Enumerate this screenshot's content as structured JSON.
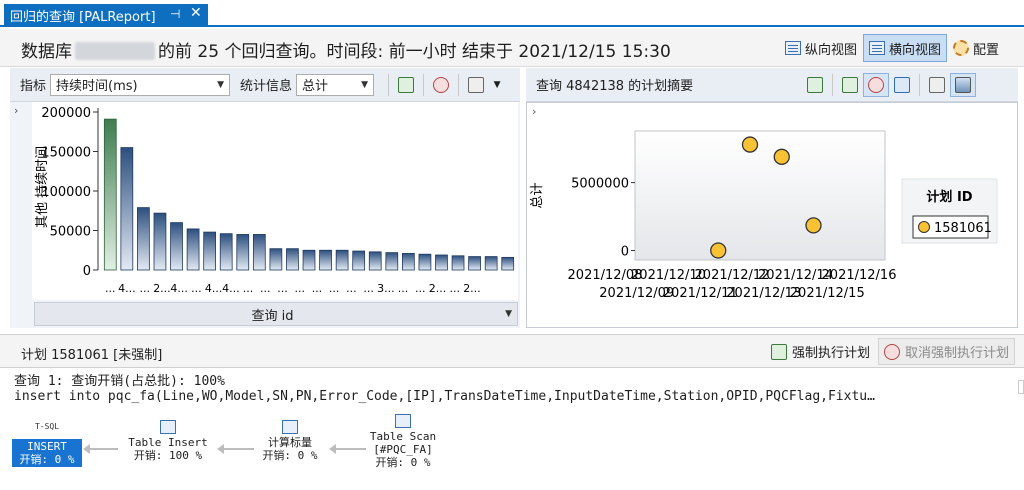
{
  "tab": {
    "title": "回归的查询 [PALReport]",
    "pin_glyph": "⊣",
    "close_glyph": "✕"
  },
  "header": {
    "prefix": "数据库",
    "suffix": "的前 25 个回归查询。时间段: 前一小时 结束于 2021/12/15 15:30",
    "views": {
      "vertical": "纵向视图",
      "horizontal": "横向视图",
      "config": "配置"
    }
  },
  "left_toolbar": {
    "metric_label": "指标",
    "metric_value": "持续时间(ms)",
    "stat_label": "统计信息",
    "stat_value": "总计"
  },
  "right_toolbar": {
    "title": "查询 4842138 的计划摘要"
  },
  "chart_data": [
    {
      "type": "bar",
      "title": "",
      "xlabel": "查询 id",
      "ylabel": "其他 持续时间",
      "ylim": [
        0,
        200000
      ],
      "yticks": [
        "0",
        "50000",
        "100000",
        "150000",
        "200000"
      ],
      "tick_values": [
        0,
        50000,
        100000,
        150000,
        200000
      ],
      "categories": [
        "...",
        "4...",
        "...",
        "2...",
        "4...",
        "...",
        "4...",
        "4...",
        "...",
        "...",
        "...",
        "...",
        "...",
        "...",
        "...",
        "...",
        "3...",
        "...",
        "...",
        "2...",
        "...",
        "2..."
      ],
      "values": [
        191000,
        155000,
        79000,
        72000,
        60000,
        52000,
        48000,
        46000,
        45000,
        45000,
        27000,
        27000,
        25000,
        25000,
        25000,
        24000,
        23000,
        22000,
        21000,
        20000,
        19000,
        18000,
        17000,
        17000,
        16000
      ],
      "selected_index": 0,
      "colors": {
        "bar": "#2d4f7e",
        "bar_light": "#e3eaf4",
        "selected": "#3f7d4f",
        "selected_light": "#e1efe3"
      }
    },
    {
      "type": "scatter",
      "title": "",
      "xlabel": "",
      "ylabel": "总计",
      "yticks": [
        "0",
        "5000000"
      ],
      "tick_values": [
        0,
        5000000
      ],
      "ylim": [
        -700000,
        8800000
      ],
      "x_tick_labels_row1": [
        "2021/12/08",
        "2021/12/10",
        "2021/12/12",
        "2021/12/14",
        "2021/12/16"
      ],
      "x_tick_labels_row2": [
        "2021/12/09",
        "2021/12/11",
        "2021/12/13",
        "2021/12/15"
      ],
      "points": [
        {
          "x": "2021/12/11",
          "y": 0
        },
        {
          "x": "2021/12/12",
          "y": 7800000
        },
        {
          "x": "2021/12/13",
          "y": 6900000
        },
        {
          "x": "2021/12/14",
          "y": 1850000
        }
      ],
      "legend": {
        "title": "计划 ID",
        "entries": [
          "1581061"
        ],
        "position": "right"
      },
      "colors": {
        "point": "#f8c234",
        "point_stroke": "#333333"
      }
    }
  ],
  "plan": {
    "title": "计划 1581061 [未强制]",
    "force_label": "强制执行计划",
    "unforce_label": "取消强制执行计划",
    "query_line": "查询 1: 查询开销(占总批): 100%",
    "sql_line": "insert into pqc_fa(Line,WO,Model,SN,PN,Error_Code,[IP],TransDateTime,InputDateTime,Station,OPID,PQCFlag,Fixtu…",
    "nodes": [
      {
        "icon_label": "T-SQL",
        "name": "INSERT",
        "cost": "开销: 0 %"
      },
      {
        "name": "Table Insert",
        "cost": "开销: 100 %"
      },
      {
        "name": "计算标量",
        "cost": "开销: 0 %"
      },
      {
        "name": "Table Scan",
        "sub": "[#PQC_FA]",
        "cost": "开销: 0 %"
      }
    ]
  }
}
